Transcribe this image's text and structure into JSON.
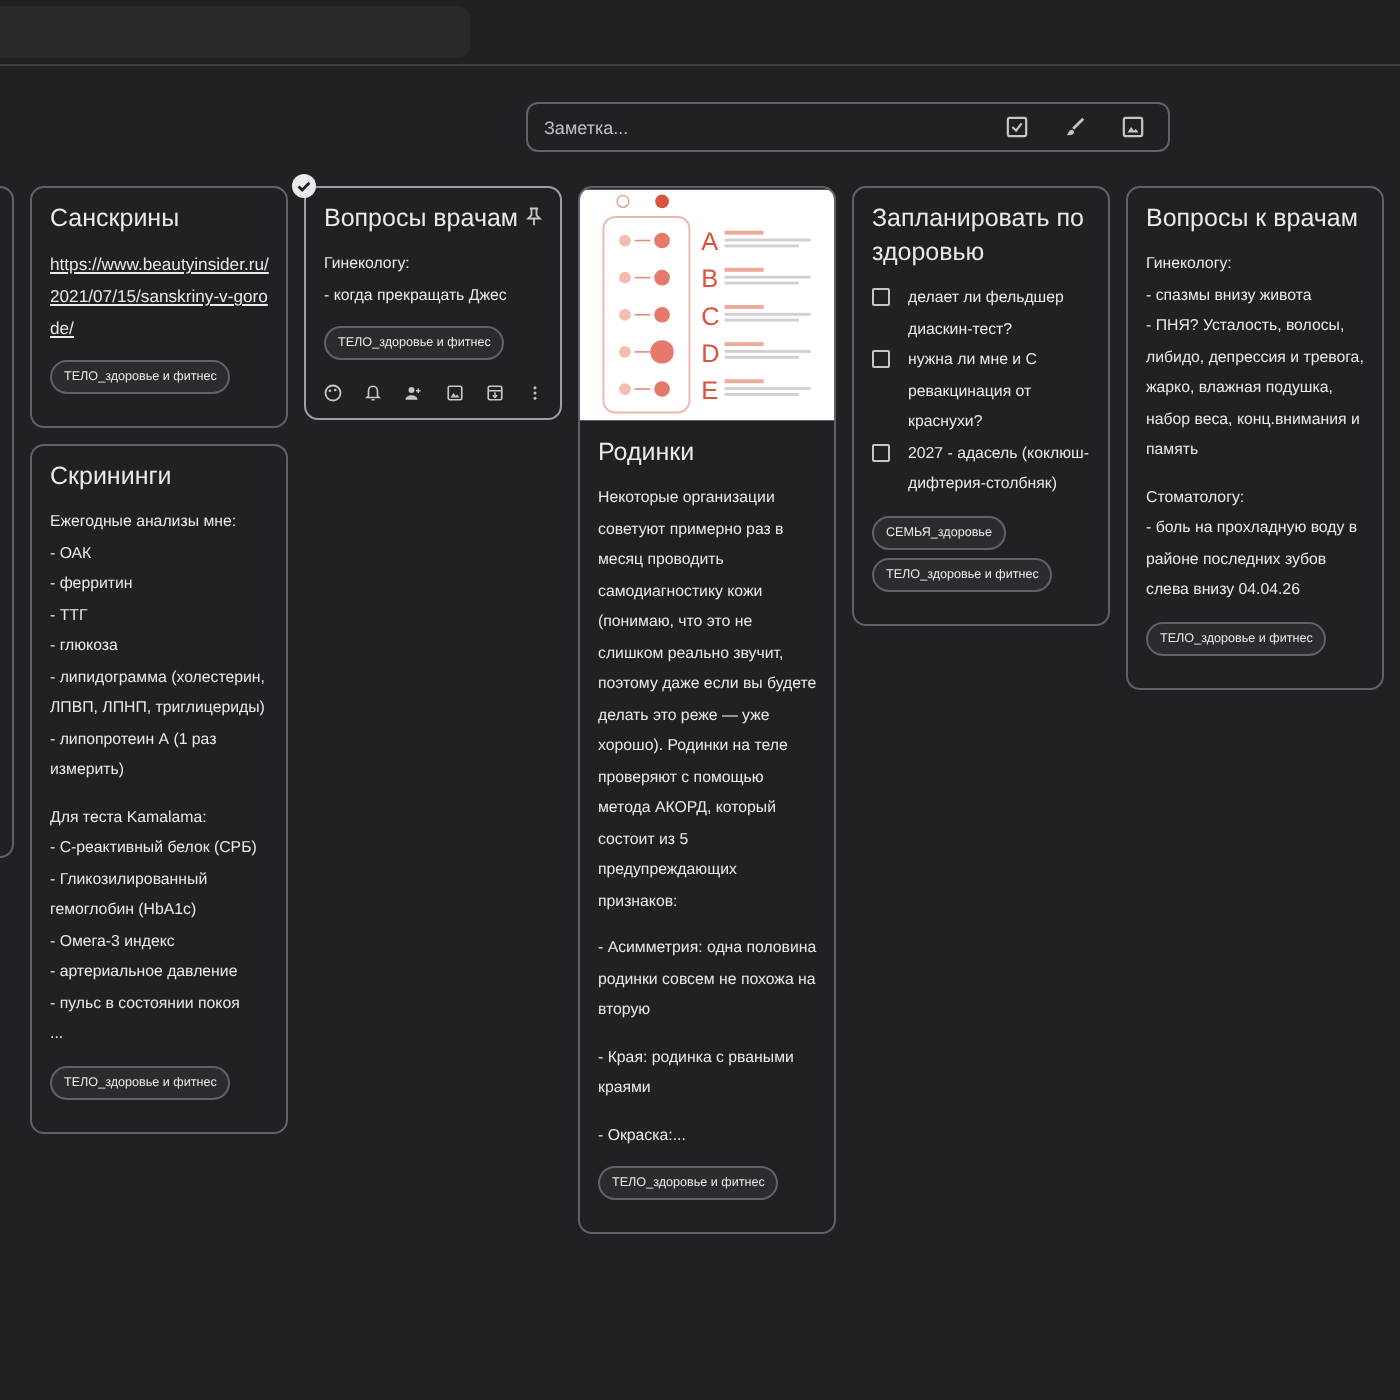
{
  "note_input": {
    "placeholder": "Заметка..."
  },
  "columns": [
    [
      {
        "title": "Санскрины",
        "selected": false,
        "body": [
          {
            "kind": "link",
            "text": "https://www.beautyinsider.ru/2021/07/15/sanskriny-v-gorode/"
          }
        ],
        "tags": [
          "ТЕЛО_здоровье и фитнес"
        ]
      },
      {
        "title": "Скрининги",
        "selected": false,
        "body": [
          {
            "kind": "text",
            "text": "Ежегодные анализы мне:\n- ОАК\n- ферритин\n- ТТГ\n- глюкоза\n- липидограмма (холестерин, ЛПВП, ЛПНП, триглицериды)\n- липопротеин А (1 раз измерить)"
          },
          {
            "kind": "text",
            "text": "Для теста Kamalama:\n- С-реактивный белок (СРБ)\n- Гликозилированный гемоглобин (HbA1c)\n- Омега-3 индекс\n- артериальное давление\n- пульс в состоянии покоя\n..."
          }
        ],
        "tags": [
          "ТЕЛО_здоровье и фитнес"
        ]
      }
    ],
    [
      {
        "title": "Вопросы врачам",
        "selected": true,
        "body": [
          {
            "kind": "text",
            "text": "Гинекологу:\n- когда прекращать Джес"
          }
        ],
        "tags": [
          "ТЕЛО_здоровье и фитнес"
        ]
      }
    ],
    [
      {
        "title": "Родинки",
        "selected": false,
        "image": {
          "letters": [
            "A",
            "B",
            "C",
            "D",
            "E"
          ]
        },
        "body": [
          {
            "kind": "text",
            "text": "Некоторые организации советуют примерно раз в месяц проводить самодиагностику кожи (понимаю, что это не слишком реально звучит, поэтому даже если вы будете делать это реже — уже хорошо). Родинки на теле проверяют с помощью метода АКОРД, который состоит из 5 предупреждающих признаков:"
          },
          {
            "kind": "text",
            "text": "- Асимметрия: одна половина родинки совсем не похожа на вторую"
          },
          {
            "kind": "text",
            "text": "- Края: родинка с рваными краями"
          },
          {
            "kind": "text",
            "text": "- Окраска:..."
          }
        ],
        "tags": [
          "ТЕЛО_здоровье и фитнес"
        ]
      }
    ],
    [
      {
        "title": "Запланировать по здоровью",
        "selected": false,
        "checklist": [
          {
            "text": "делает ли фельдшер диаскин-тест?",
            "checked": false
          },
          {
            "text": "нужна ли мне и С ревакцинация от краснухи?",
            "checked": false
          },
          {
            "text": "2027 - адасель (коклюш-дифтерия-столбняк)",
            "checked": false
          }
        ],
        "tags": [
          "СЕМЬЯ_здоровье",
          "ТЕЛО_здоровье и фитнес"
        ]
      }
    ],
    [
      {
        "title": "Вопросы к врачам",
        "selected": false,
        "body": [
          {
            "kind": "text",
            "text": "Гинекологу:\n- спазмы внизу живота\n- ПНЯ? Усталость, волосы, либидо, депрессия и тревога, жарко, влажная подушка, набор веса, конц.внимания и память"
          },
          {
            "kind": "text",
            "text": "Стоматологу:\n- боль на прохладную воду в районе последних зубов слева внизу 04.04.26"
          }
        ],
        "tags": [
          "ТЕЛО_здоровье и фитнес"
        ]
      }
    ]
  ]
}
